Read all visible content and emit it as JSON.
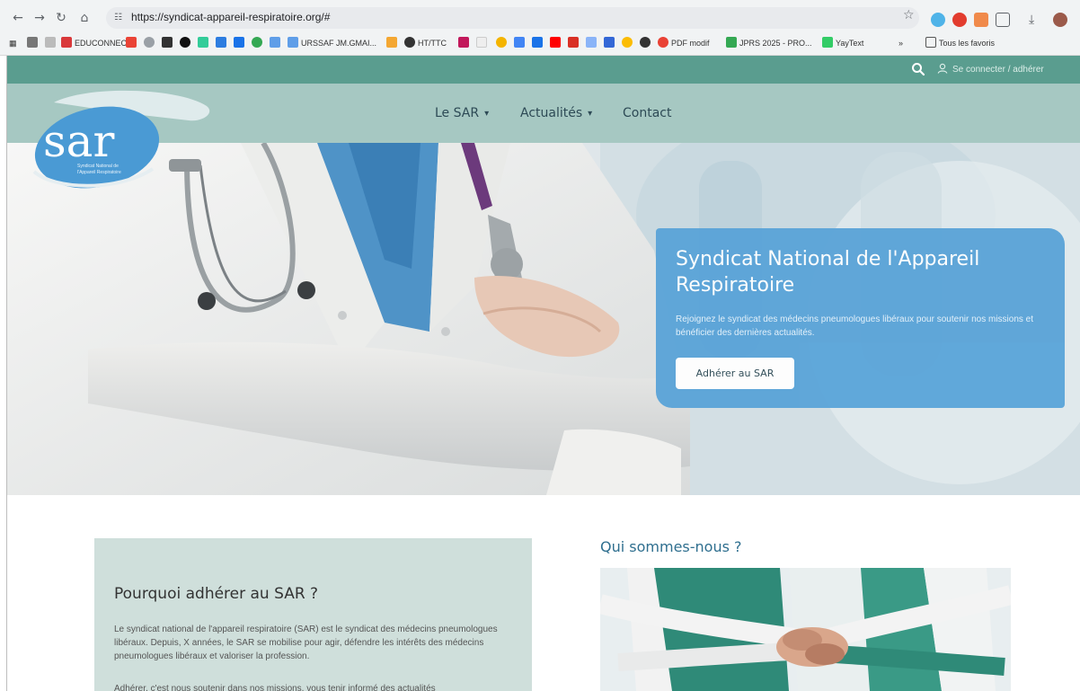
{
  "browser": {
    "url": "https://syndicat-appareil-respiratoire.org/#",
    "bookmarks": [
      "EDUCONNECT",
      "URSSAF JM.GMAI...",
      "HT/TTC",
      "PDF modif",
      "JPRS 2025 - PRO...",
      "YayText",
      "Tous les favoris"
    ],
    "icons": [
      "back-icon",
      "forward-icon",
      "reload-icon",
      "home-icon",
      "star-icon",
      "download-icon"
    ]
  },
  "topbar": {
    "login_label": "Se connecter / adhérer",
    "color": "#5a9d8f"
  },
  "nav": {
    "items": [
      {
        "label": "Le SAR",
        "has_dropdown": true
      },
      {
        "label": "Actualités",
        "has_dropdown": true
      },
      {
        "label": "Contact",
        "has_dropdown": false
      }
    ],
    "background": "#a6c8c2"
  },
  "logo": {
    "text": "sar",
    "tagline_line1": "Syndicat National de",
    "tagline_line2": "l'Appareil Respiratoire"
  },
  "hero": {
    "title": "Syndicat National de l'Appareil Respiratoire",
    "subtitle": "Rejoignez le syndicat des médecins pneumologues libéraux pour soutenir nos missions et bénéficier des dernières actualités.",
    "button_label": "Adhérer au SAR",
    "card_color": "#5ba4d8"
  },
  "why": {
    "title": "Pourquoi adhérer au SAR ?",
    "paragraph1": "Le syndicat national de l'appareil respiratoire (SAR) est le syndicat des médecins pneumologues libéraux. Depuis, X années, le SAR se mobilise pour agir, défendre les intérêts des médecins pneumologues libéraux et valoriser la profession.",
    "paragraph2": "Adhérer, c'est nous soutenir dans nos missions, vous tenir informé des actualités"
  },
  "who": {
    "title": "Qui sommes-nous ?"
  }
}
